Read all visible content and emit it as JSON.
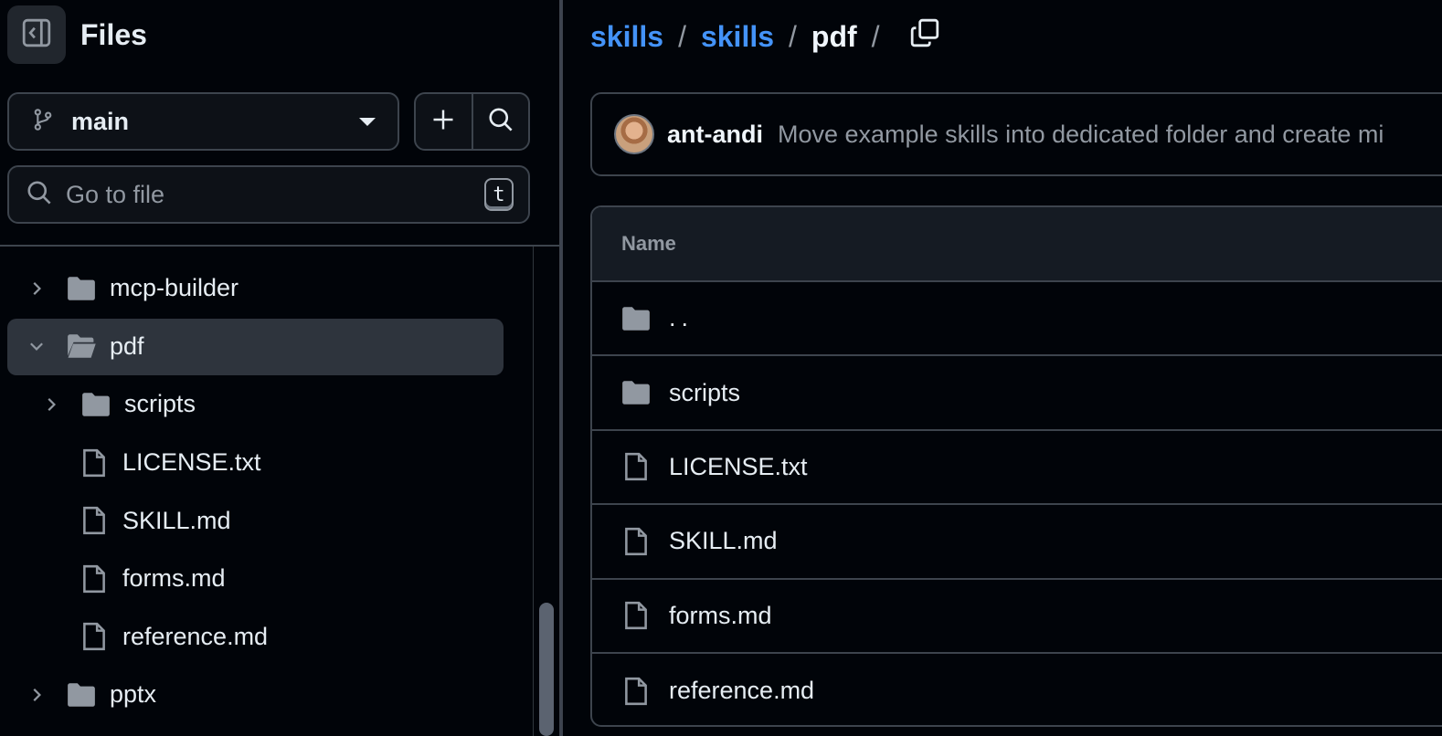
{
  "sidebar": {
    "title": "Files",
    "branch": "main",
    "goto_placeholder": "Go to file",
    "goto_shortcut": "t",
    "tree": [
      {
        "label": "mcp-builder",
        "type": "folder",
        "expanded": false,
        "depth": 0
      },
      {
        "label": "pdf",
        "type": "folder-open",
        "expanded": true,
        "depth": 0,
        "active": true
      },
      {
        "label": "scripts",
        "type": "folder",
        "expanded": false,
        "depth": 1
      },
      {
        "label": "LICENSE.txt",
        "type": "file",
        "depth": 1
      },
      {
        "label": "SKILL.md",
        "type": "file",
        "depth": 1
      },
      {
        "label": "forms.md",
        "type": "file",
        "depth": 1
      },
      {
        "label": "reference.md",
        "type": "file",
        "depth": 1
      },
      {
        "label": "pptx",
        "type": "folder",
        "expanded": false,
        "depth": 0
      }
    ]
  },
  "breadcrumb": {
    "items": [
      "skills",
      "skills"
    ],
    "current": "pdf",
    "separator": "/"
  },
  "commit": {
    "author": "ant-andi",
    "message": "Move example skills into dedicated folder and create mi"
  },
  "table": {
    "header": "Name",
    "rows": [
      {
        "name": "..",
        "type": "folder"
      },
      {
        "name": "scripts",
        "type": "folder"
      },
      {
        "name": "LICENSE.txt",
        "type": "file"
      },
      {
        "name": "SKILL.md",
        "type": "file"
      },
      {
        "name": "forms.md",
        "type": "file"
      },
      {
        "name": "reference.md",
        "type": "file"
      }
    ]
  },
  "colors": {
    "background": "#010409",
    "link": "#4493f8",
    "border": "#3d444d",
    "active_row": "#2e343d"
  }
}
